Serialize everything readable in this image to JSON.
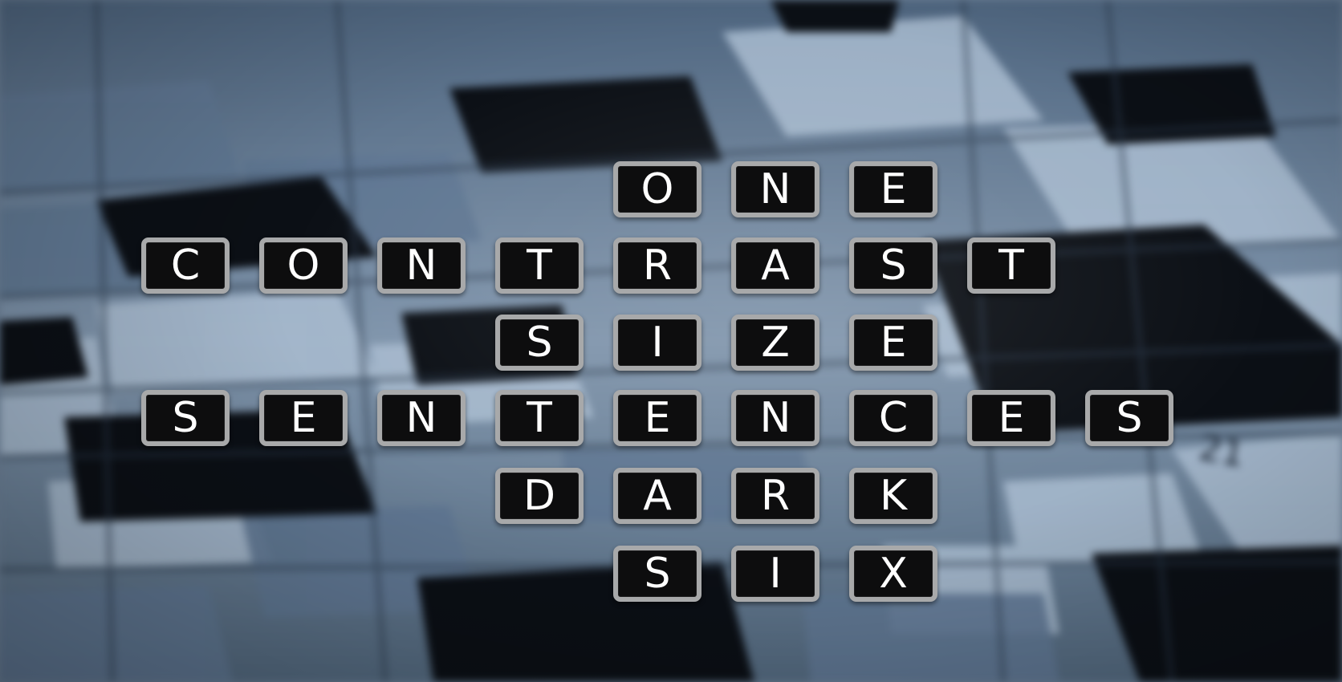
{
  "puzzle": {
    "words": [
      "ONE",
      "CONTRAST",
      "SIZE",
      "SENTENCES",
      "DARK",
      "SIX"
    ]
  },
  "background": {
    "grid_number": "21",
    "colors": {
      "dark_cell": "#0c1016",
      "light_cell": "#9fb3c8",
      "mid_cell": "#5d7590",
      "tile_face": "#0d0d0e",
      "tile_border": "#a8a9aa",
      "letter": "#ffffff"
    }
  }
}
